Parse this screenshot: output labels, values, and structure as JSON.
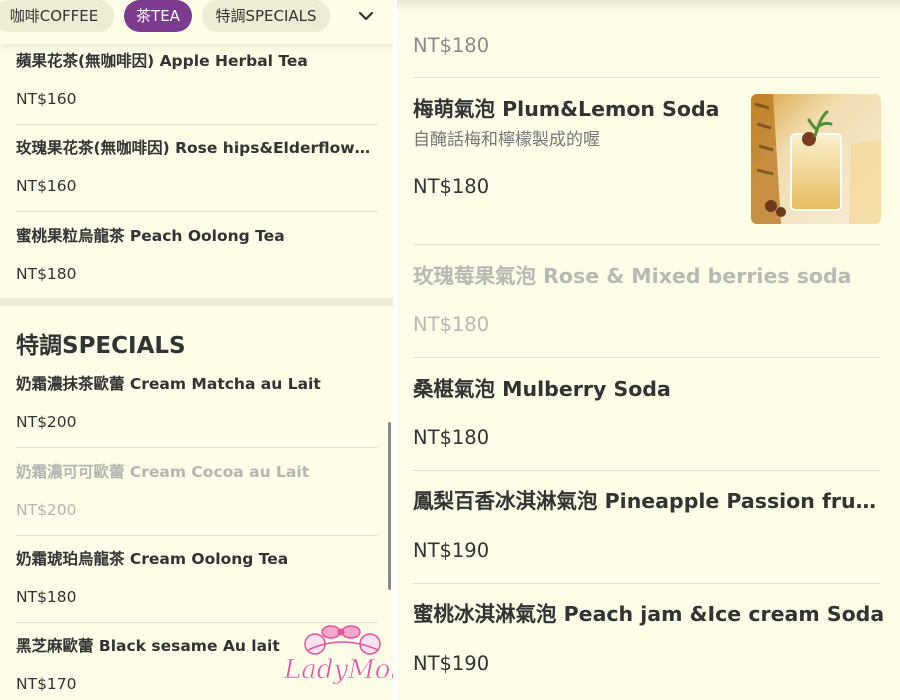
{
  "left": {
    "tabs": [
      {
        "label": "咖啡COFFEE",
        "active": false
      },
      {
        "label": "茶TEA",
        "active": true
      },
      {
        "label": "特調SPECIALS",
        "active": false
      }
    ],
    "tea_items": [
      {
        "name": "蘋果花茶(無咖啡因) Apple Herbal Tea",
        "price": "NT$160"
      },
      {
        "name": "玫瑰果花茶(無咖啡因) Rose hips&Elderflower…",
        "price": "NT$160"
      },
      {
        "name": "蜜桃果粒烏龍茶 Peach Oolong Tea",
        "price": "NT$180"
      }
    ],
    "specials_title": "特調SPECIALS",
    "special_items": [
      {
        "name": "奶霜濃抹茶歐蕾 Cream Matcha au Lait",
        "price": "NT$200"
      },
      {
        "name": "奶霜濃可可歐蕾 Cream Cocoa au Lait",
        "price": "NT$200"
      },
      {
        "name": "奶霜琥珀烏龍茶 Cream Oolong Tea",
        "price": "NT$180"
      },
      {
        "name": "黑芝麻歐蕾 Black sesame Au lait",
        "price": "NT$170"
      }
    ],
    "watermark": "LadyMoko"
  },
  "right": {
    "top_price": "NT$180",
    "items": [
      {
        "name": "梅萌氣泡 Plum&Lemon Soda",
        "desc": "自醃話梅和檸檬製成的喔",
        "price": "NT$180"
      },
      {
        "name": "玫瑰莓果氣泡 Rose & Mixed berries soda",
        "price": "NT$180"
      },
      {
        "name": "桑椹氣泡 Mulberry Soda",
        "price": "NT$180"
      },
      {
        "name": "鳳梨百香冰淇淋氣泡 Pineapple Passion fruit I…",
        "price": "NT$190"
      },
      {
        "name": "蜜桃冰淇淋氣泡 Peach jam &Ice cream Soda",
        "price": "NT$190"
      }
    ]
  },
  "colors": {
    "background": "#fdfce6",
    "active_tab": "#7d3b8f",
    "chip": "#ecebd3",
    "text": "#333333",
    "disabled_text": "#b6b6b0",
    "watermark_pink": "#e4559d"
  }
}
